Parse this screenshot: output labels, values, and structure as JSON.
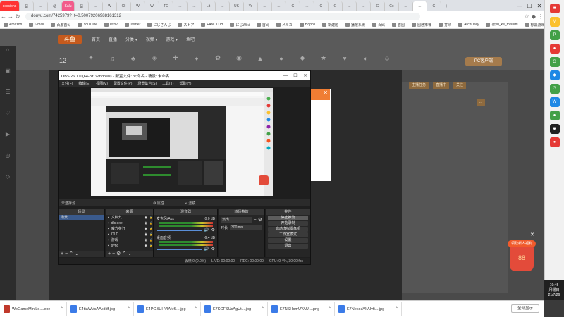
{
  "browser": {
    "tabs": [
      "sessions",
      "蘇",
      "...",
      "頓",
      "Salu",
      "蘇",
      "...",
      "W",
      "Cli",
      "W",
      "W",
      "TC",
      "...",
      "...",
      "Lit",
      "...",
      "UK",
      "Yo",
      "...",
      "...",
      "G",
      "...",
      "G",
      "G",
      "...",
      "...",
      "G",
      "Co",
      "...",
      "...",
      "G"
    ],
    "new_tab": "+",
    "url": "douyu.com/7425979?_t=0.50079206988161312",
    "bookmarks": [
      "Amazon",
      "Gmail",
      "百度首码",
      "YouTube",
      "Pixiv",
      "Twitter",
      "にじさんじ",
      "ストア",
      "FANCLUB",
      "にじWiki",
      "首码",
      "メルカ",
      "Hoppii",
      "新建题",
      "播报系统",
      "百码",
      "首图",
      "图通推荐",
      "打印",
      "ArchDaily",
      "@yu_ke_misumi",
      "标黑游戏"
    ]
  },
  "site": {
    "logo": "斗鱼",
    "nav": [
      "首页",
      "直播",
      "分类 ▾",
      "视频 ▾",
      "游戏 ▾",
      "鱼吧"
    ],
    "count": "12",
    "pc_button": "PC客户端",
    "room_buttons": [
      "主播任务",
      "直播中",
      "关注"
    ],
    "side_button": "..."
  },
  "obs": {
    "title": "OBS 26.1.0 (64-bit, windows) - 配置文件: 未命名 - 场景: 未命名",
    "menu": [
      "文件(F)",
      "编辑(E)",
      "视图(V)",
      "配置文件(P)",
      "场景集合(S)",
      "工具(T)",
      "帮助(H)"
    ],
    "status_left": "未选择源",
    "toolbar": [
      "属性",
      "滤镜"
    ],
    "docks": {
      "scenes": {
        "title": "场景",
        "items": [
          "场景"
        ]
      },
      "sources": {
        "title": "来源",
        "items": [
          "文稿九",
          "dlc.exe",
          "魔方英订",
          "OLD",
          "游戏",
          "sync"
        ]
      },
      "mixer": {
        "title": "混音器",
        "channels": [
          {
            "name": "麦克风/Aux",
            "db": "0.0 dB"
          },
          {
            "name": "桌面音频",
            "db": "-6.4 dB"
          }
        ]
      },
      "transitions": {
        "title": "转场特效",
        "type": "淡出",
        "duration_label": "时长",
        "duration": "300 ms"
      },
      "controls": {
        "title": "控件",
        "buttons": [
          "停止推流",
          "开始录制",
          "启动虚拟摄像机",
          "工作室模式",
          "设置",
          "退出"
        ]
      }
    },
    "statusbar": {
      "dropped": "丢帧 0 (0.0%)",
      "live": "LIVE: 00:00:00",
      "rec": "REC: 00:00:00",
      "cpu": "CPU: 0.4%, 30.00 fps"
    }
  },
  "promo": {
    "tag": "领取新人福利",
    "amount": "88"
  },
  "downloads": {
    "items": [
      "WeGameMiniLo....exe",
      "E4ttaWVcAAxddf.jpg",
      "E4PGBUHVIAIvS....jpg",
      "E7KGFSUcAgUt....jpg",
      "E7NSHomUYAU....png",
      "E7NekoaVkAIvfi....jpg"
    ],
    "show_all": "全部显示"
  },
  "clock": {
    "time": "19:45",
    "day": "月曜日",
    "date": "21/7/26"
  }
}
